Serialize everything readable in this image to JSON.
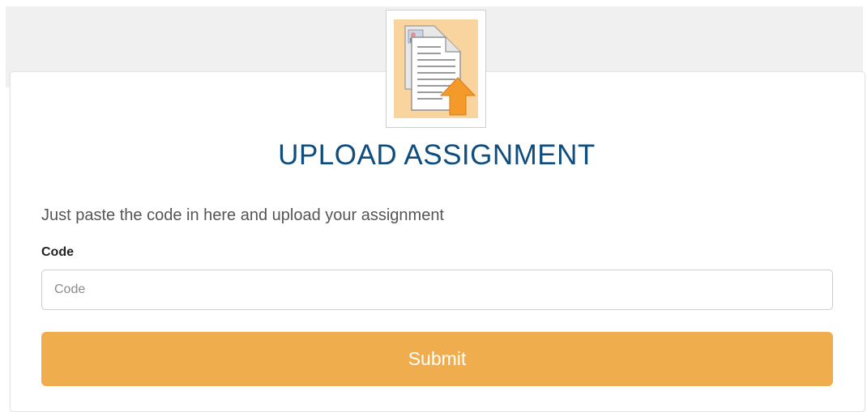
{
  "header": {
    "logo_icon": "upload-document-icon",
    "title": "UPLOAD ASSIGNMENT"
  },
  "form": {
    "intro": "Just paste the code in here and upload your assignment",
    "code_label": "Code",
    "code_placeholder": "Code",
    "code_value": "",
    "submit_label": "Submit"
  },
  "colors": {
    "title": "#0f4d7e",
    "submit_bg": "#efad4d",
    "submit_text": "#ffffff",
    "band": "#f0f0f0",
    "logo_bg": "#f9d49e",
    "arrow": "#f39a2b"
  }
}
